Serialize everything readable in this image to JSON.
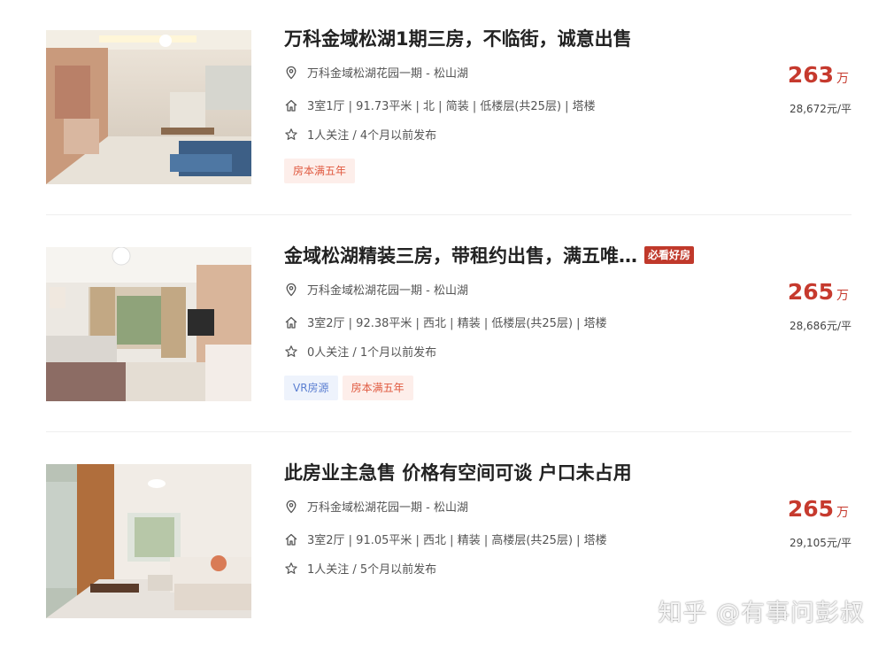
{
  "listings": [
    {
      "title": "万科金域松湖1期三房，不临街，诚意出售",
      "badge": "",
      "location": "万科金域松湖花园一期 - 松山湖",
      "info": "3室1厅 | 91.73平米 | 北 | 简装 | 低楼层(共25层) | 塔楼",
      "follow": "1人关注 / 4个月以前发布",
      "tags": [
        "房本满五年"
      ],
      "price": "263",
      "price_unit": "万",
      "unit_price": "28,672元/平"
    },
    {
      "title": "金域松湖精装三房，带租约出售，满五唯…",
      "badge": "必看好房",
      "location": "万科金域松湖花园一期 - 松山湖",
      "info": "3室2厅 | 92.38平米 | 西北 | 精装 | 低楼层(共25层) | 塔楼",
      "follow": "0人关注 / 1个月以前发布",
      "tags": [
        "VR房源",
        "房本满五年"
      ],
      "price": "265",
      "price_unit": "万",
      "unit_price": "28,686元/平"
    },
    {
      "title": "此房业主急售 价格有空间可谈 户口未占用",
      "badge": "",
      "location": "万科金域松湖花园一期 - 松山湖",
      "info": "3室2厅 | 91.05平米 | 西北 | 精装 | 高楼层(共25层) | 塔楼",
      "follow": "1人关注 / 5个月以前发布",
      "tags": [],
      "price": "265",
      "price_unit": "万",
      "unit_price": "29,105元/平"
    }
  ],
  "icons": {
    "location": "location-pin-icon",
    "house": "house-icon",
    "star": "star-outline-icon"
  },
  "colors": {
    "price": "#c63a2e",
    "badge": "#c0392b",
    "tag_red_bg": "#fdeeea",
    "tag_red_text": "#e0593f",
    "tag_blue_bg": "#eef3fc",
    "tag_blue_text": "#5b7fd1"
  },
  "watermark": "知乎 @有事问彭叔"
}
